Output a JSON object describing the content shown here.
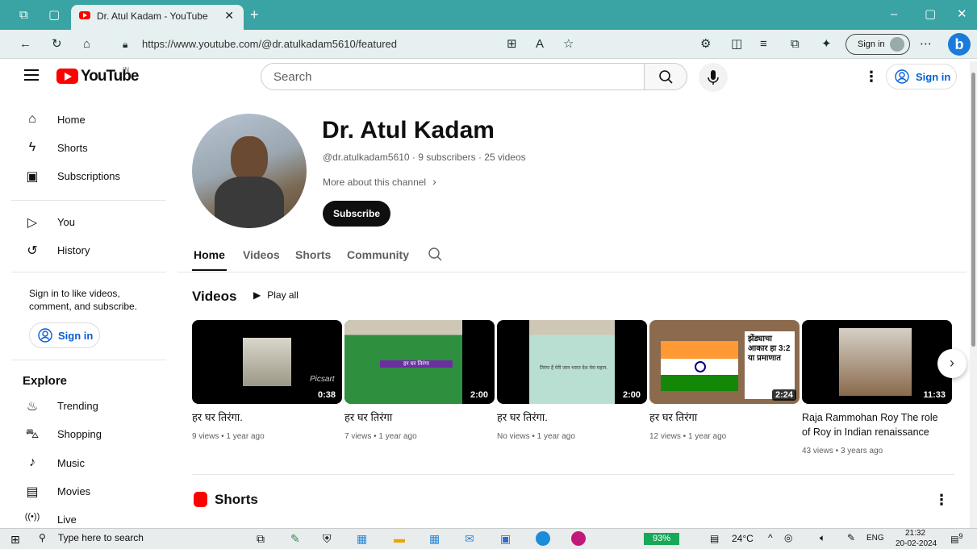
{
  "browser": {
    "tab_title": "Dr. Atul Kadam - YouTube",
    "url": "https://www.youtube.com/@dr.atulkadam5610/featured",
    "signin_label": "Sign in"
  },
  "header": {
    "logo_text": "YouTube",
    "region": "IN",
    "search_placeholder": "Search",
    "signin_label": "Sign in"
  },
  "sidebar": {
    "items_top": [
      {
        "label": "Home",
        "icon": "home-icon"
      },
      {
        "label": "Shorts",
        "icon": "shorts-icon"
      },
      {
        "label": "Subscriptions",
        "icon": "subscriptions-icon"
      }
    ],
    "items_you": [
      {
        "label": "You",
        "icon": "you-icon"
      },
      {
        "label": "History",
        "icon": "history-icon"
      }
    ],
    "signin_prompt": "Sign in to like videos, comment, and subscribe.",
    "signin_label": "Sign in",
    "explore_heading": "Explore",
    "explore_items": [
      {
        "label": "Trending",
        "icon": "trending-icon"
      },
      {
        "label": "Shopping",
        "icon": "shopping-icon"
      },
      {
        "label": "Music",
        "icon": "music-icon"
      },
      {
        "label": "Movies",
        "icon": "movies-icon"
      },
      {
        "label": "Live",
        "icon": "live-icon"
      }
    ]
  },
  "channel": {
    "name": "Dr. Atul Kadam",
    "handle_line": "@dr.atulkadam5610 · 9 subscribers · 25 videos",
    "more_about": "More about this channel",
    "subscribe_label": "Subscribe",
    "tabs": [
      "Home",
      "Videos",
      "Shorts",
      "Community"
    ],
    "active_tab": "Home"
  },
  "videos_section": {
    "heading": "Videos",
    "play_all": "Play all",
    "videos": [
      {
        "title": "हर घर तिरंगा.",
        "duration": "0:38",
        "meta": "9 views • 1 year ago",
        "overlay": "Picsart"
      },
      {
        "title": "हर घर तिरंगा",
        "duration": "2:00",
        "meta": "7 views • 1 year ago",
        "overlay": "हर घर तिरंगा"
      },
      {
        "title": "हर घर तिरंगा.",
        "duration": "2:00",
        "meta": "No views • 1 year ago",
        "overlay": "तिरंगा है मेरी जान भारत देश मेरा महान."
      },
      {
        "title": "हर घर तिरंगा",
        "duration": "2:24",
        "meta": "12 views • 1 year ago",
        "overlay": "झेंड्याचा आकार हा 3:2 या प्रमाणात"
      },
      {
        "title": "Raja Rammohan Roy The role of Roy in Indian renaissance",
        "duration": "11:33",
        "meta": "43 views • 3 years ago",
        "overlay": ""
      }
    ]
  },
  "shorts_section": {
    "heading": "Shorts"
  },
  "taskbar": {
    "search_placeholder": "Type here to search",
    "battery": "93%",
    "temperature": "24°C",
    "language": "ENG",
    "time": "21:32",
    "date": "20-02-2024",
    "notifications": "9"
  },
  "colors": {
    "accent": "#065fd4",
    "brand_red": "#ff0000",
    "tabbar": "#3aa3a3"
  }
}
